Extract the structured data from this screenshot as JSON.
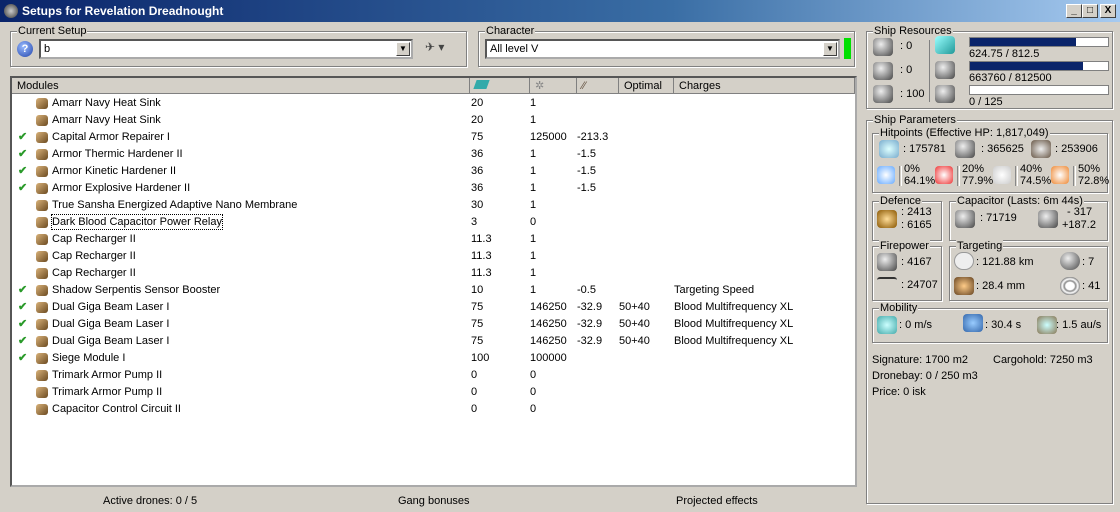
{
  "window": {
    "title": "Setups for Revelation Dreadnought",
    "minimize": "_",
    "maximize": "□",
    "close": "X"
  },
  "current_setup": {
    "label": "Current Setup",
    "value": "b"
  },
  "character": {
    "label": "Character",
    "value": "All level V",
    "status_color": "#00e000"
  },
  "modules_table": {
    "columns": [
      "Modules",
      "cpu-icon",
      "powergrid-icon",
      "capacitor-icon",
      "Optimal",
      "Charges"
    ],
    "rows": [
      {
        "active": false,
        "name": "Amarr Navy Heat Sink",
        "cpu": "20",
        "pg": "1",
        "cap": "",
        "optimal": "",
        "charges": ""
      },
      {
        "active": false,
        "name": "Amarr Navy Heat Sink",
        "cpu": "20",
        "pg": "1",
        "cap": "",
        "optimal": "",
        "charges": ""
      },
      {
        "active": true,
        "name": "Capital Armor Repairer I",
        "cpu": "75",
        "pg": "125000",
        "cap": "-213.3",
        "optimal": "",
        "charges": ""
      },
      {
        "active": true,
        "name": "Armor Thermic Hardener II",
        "cpu": "36",
        "pg": "1",
        "cap": "-1.5",
        "optimal": "",
        "charges": ""
      },
      {
        "active": true,
        "name": "Armor Kinetic Hardener II",
        "cpu": "36",
        "pg": "1",
        "cap": "-1.5",
        "optimal": "",
        "charges": ""
      },
      {
        "active": true,
        "name": "Armor Explosive Hardener II",
        "cpu": "36",
        "pg": "1",
        "cap": "-1.5",
        "optimal": "",
        "charges": ""
      },
      {
        "active": false,
        "name": "True Sansha Energized Adaptive Nano Membrane",
        "cpu": "30",
        "pg": "1",
        "cap": "",
        "optimal": "",
        "charges": ""
      },
      {
        "active": false,
        "name": "Dark Blood Capacitor Power Relay",
        "cpu": "3",
        "pg": "0",
        "cap": "",
        "optimal": "",
        "charges": "",
        "selected": true
      },
      {
        "active": false,
        "name": "Cap Recharger II",
        "cpu": "11.3",
        "pg": "1",
        "cap": "",
        "optimal": "",
        "charges": ""
      },
      {
        "active": false,
        "name": "Cap Recharger II",
        "cpu": "11.3",
        "pg": "1",
        "cap": "",
        "optimal": "",
        "charges": ""
      },
      {
        "active": false,
        "name": "Cap Recharger II",
        "cpu": "11.3",
        "pg": "1",
        "cap": "",
        "optimal": "",
        "charges": ""
      },
      {
        "active": true,
        "name": "Shadow Serpentis Sensor Booster",
        "cpu": "10",
        "pg": "1",
        "cap": "-0.5",
        "optimal": "",
        "charges": "Targeting Speed"
      },
      {
        "active": true,
        "name": "Dual Giga Beam Laser I",
        "cpu": "75",
        "pg": "146250",
        "cap": "-32.9",
        "optimal": "50+40",
        "charges": "Blood Multifrequency XL"
      },
      {
        "active": true,
        "name": "Dual Giga Beam Laser I",
        "cpu": "75",
        "pg": "146250",
        "cap": "-32.9",
        "optimal": "50+40",
        "charges": "Blood Multifrequency XL"
      },
      {
        "active": true,
        "name": "Dual Giga Beam Laser I",
        "cpu": "75",
        "pg": "146250",
        "cap": "-32.9",
        "optimal": "50+40",
        "charges": "Blood Multifrequency XL"
      },
      {
        "active": true,
        "name": "Siege Module I",
        "cpu": "100",
        "pg": "100000",
        "cap": "",
        "optimal": "",
        "charges": ""
      },
      {
        "active": false,
        "name": "Trimark Armor Pump II",
        "cpu": "0",
        "pg": "0",
        "cap": "",
        "optimal": "",
        "charges": ""
      },
      {
        "active": false,
        "name": "Trimark Armor Pump II",
        "cpu": "0",
        "pg": "0",
        "cap": "",
        "optimal": "",
        "charges": ""
      },
      {
        "active": false,
        "name": "Capacitor Control Circuit II",
        "cpu": "0",
        "pg": "0",
        "cap": "",
        "optimal": "",
        "charges": ""
      }
    ]
  },
  "status_bar": {
    "drones": "Active drones: 0 / 5",
    "gang": "Gang bonuses",
    "projected": "Projected effects"
  },
  "resources": {
    "label": "Ship Resources",
    "turrets": ": 0",
    "launchers": ": 0",
    "calibration": ": 100",
    "cpu": "624.75 / 812.5",
    "cpu_fraction": 0.769,
    "powergrid": "663760 / 812500",
    "pg_fraction": 0.817,
    "drone_bw": "0 / 125",
    "drone_fraction": 0
  },
  "parameters": {
    "label": "Ship Parameters",
    "hitpoints": {
      "label": "Hitpoints (Effective HP: 1,817,049)",
      "shield": ": 175781",
      "armor": ": 365625",
      "structure": ": 253906",
      "res": [
        {
          "top": "0%",
          "bottom": "64.1%"
        },
        {
          "top": "20%",
          "bottom": "77.9%"
        },
        {
          "top": "40%",
          "bottom": "74.5%"
        },
        {
          "top": "50%",
          "bottom": "72.8%"
        }
      ]
    },
    "defence": {
      "label": "Defence",
      "a": ": 2413",
      "b": ": 6165"
    },
    "capacitor": {
      "label": "Capacitor (Lasts: 6m 44s)",
      "amount": ": 71719",
      "use": "- 317",
      "recharge": "+187.2"
    },
    "firepower": {
      "label": "Firepower",
      "a": ": 4167",
      "b": ": 24707"
    },
    "targeting": {
      "label": "Targeting",
      "range": ": 121.88 km",
      "targets": ": 7",
      "resolution": ": 28.4 mm",
      "sensor": ": 41"
    },
    "mobility": {
      "label": "Mobility",
      "speed": ": 0 m/s",
      "align": ": 30.4 s",
      "warp": ": 1.5 au/s"
    },
    "signature": "Signature: 1700 m2",
    "cargohold": "Cargohold: 7250 m3",
    "dronebay": "Dronebay: 0 / 250 m3",
    "price": "Price: 0 isk"
  }
}
